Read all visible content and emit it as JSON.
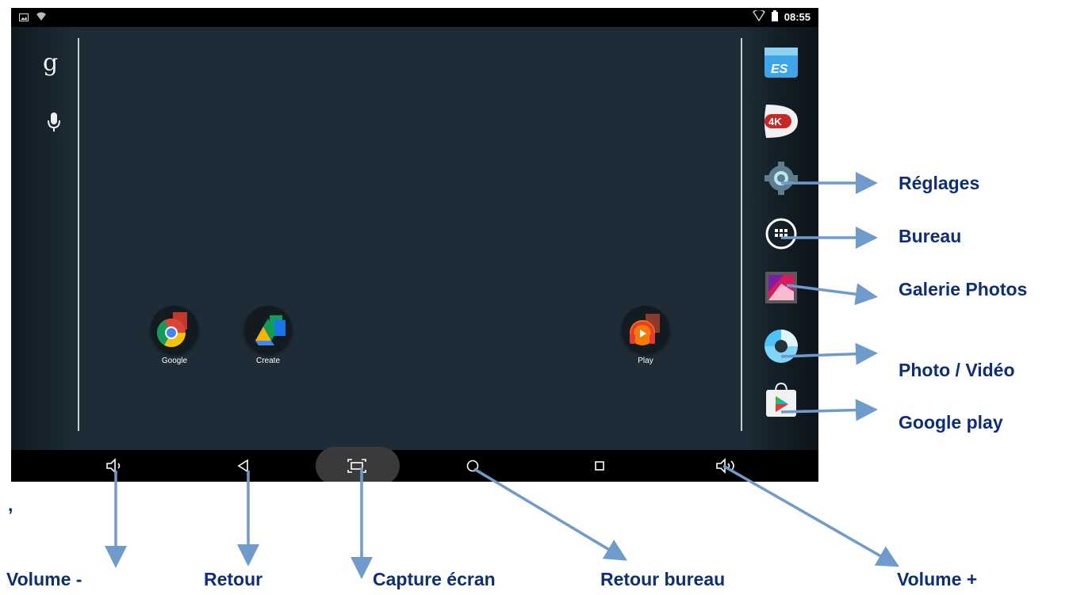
{
  "status_bar": {
    "time": "08:55"
  },
  "home_apps": [
    {
      "label": "Google"
    },
    {
      "label": "Create"
    },
    {
      "label": "Play"
    }
  ],
  "dock_badges": {
    "es": "ES",
    "video4k": "4K"
  },
  "annotations": {
    "reglages": "Réglages",
    "bureau": "Bureau",
    "galerie": "Galerie Photos",
    "photo_video": "Photo / Vidéo",
    "google_play": "Google play",
    "volume_minus": "Volume -",
    "retour": "Retour",
    "capture": "Capture écran",
    "retour_bureau": "Retour bureau",
    "volume_plus": "Volume +",
    "comma": ","
  },
  "colors": {
    "annotation_text": "#0d2e7a",
    "arrow": "#6f9bcc",
    "screen_bg": "#1d2c36"
  }
}
